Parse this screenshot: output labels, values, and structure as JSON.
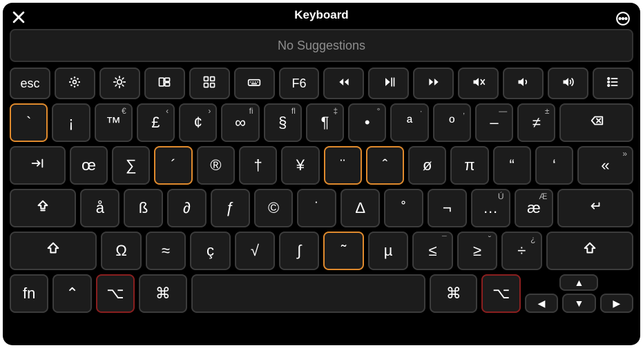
{
  "title": "Keyboard",
  "suggestions": "No Suggestions",
  "function_row": [
    {
      "name": "esc-key",
      "label": "esc",
      "glyph": "text"
    },
    {
      "name": "brightness-down-key",
      "glyph": "bright-low"
    },
    {
      "name": "brightness-up-key",
      "glyph": "bright-high"
    },
    {
      "name": "mission-control-key",
      "glyph": "mission"
    },
    {
      "name": "launchpad-key",
      "glyph": "grid"
    },
    {
      "name": "keyboard-light-key",
      "glyph": "kbd"
    },
    {
      "name": "f6-key",
      "label": "F6",
      "glyph": "text"
    },
    {
      "name": "rewind-key",
      "glyph": "rw"
    },
    {
      "name": "play-pause-key",
      "glyph": "play"
    },
    {
      "name": "forward-key",
      "glyph": "ff"
    },
    {
      "name": "mute-key",
      "glyph": "mute"
    },
    {
      "name": "volume-down-key",
      "glyph": "vol-low"
    },
    {
      "name": "volume-up-key",
      "glyph": "vol-high"
    },
    {
      "name": "list-key",
      "glyph": "list"
    }
  ],
  "row1": [
    {
      "name": "grave-key",
      "label": "`",
      "hl": "orange"
    },
    {
      "name": "inverted-exclamation-key",
      "label": "¡"
    },
    {
      "name": "trademark-key",
      "label": "™",
      "hint": "€"
    },
    {
      "name": "pound-key",
      "label": "£",
      "hint": "‹"
    },
    {
      "name": "cent-key",
      "label": "¢",
      "hint": "›"
    },
    {
      "name": "infinity-key",
      "label": "∞",
      "hint": "ﬁ"
    },
    {
      "name": "section-key",
      "label": "§",
      "hint": "ﬂ"
    },
    {
      "name": "paragraph-key",
      "label": "¶",
      "hint": "‡"
    },
    {
      "name": "bullet-key",
      "label": "•",
      "hint": "°"
    },
    {
      "name": "ordfem-key",
      "label": "ª",
      "hint": "·"
    },
    {
      "name": "ordmasc-key",
      "label": "º",
      "hint": "‚"
    },
    {
      "name": "endash-key",
      "label": "–",
      "hint": "—"
    },
    {
      "name": "notequal-key",
      "label": "≠",
      "hint": "±"
    },
    {
      "name": "delete-key",
      "glyph": "delete",
      "w": "w200"
    }
  ],
  "row2": [
    {
      "name": "tab-key",
      "glyph": "tab",
      "w": "w150"
    },
    {
      "name": "oe-key",
      "label": "œ"
    },
    {
      "name": "sigma-key",
      "label": "∑"
    },
    {
      "name": "acute-key",
      "label": "´",
      "hl": "orange"
    },
    {
      "name": "registered-key",
      "label": "®"
    },
    {
      "name": "dagger-key",
      "label": "†"
    },
    {
      "name": "yen-key",
      "label": "¥"
    },
    {
      "name": "diaeresis-key",
      "label": "¨",
      "hl": "orange"
    },
    {
      "name": "caret-key",
      "label": "ˆ",
      "hl": "orange"
    },
    {
      "name": "oslash-key",
      "label": "ø"
    },
    {
      "name": "pi-key",
      "label": "π"
    },
    {
      "name": "open-quote-key",
      "label": "“"
    },
    {
      "name": "close-quote-key",
      "label": "‘"
    },
    {
      "name": "guillemet-key",
      "label": "«",
      "hint": "»",
      "w": "w150"
    }
  ],
  "row3": [
    {
      "name": "capslock-key",
      "glyph": "caps",
      "w": "w175"
    },
    {
      "name": "aring-key",
      "label": "å"
    },
    {
      "name": "eszett-key",
      "label": "ß"
    },
    {
      "name": "partial-key",
      "label": "∂"
    },
    {
      "name": "florin-key",
      "label": "ƒ"
    },
    {
      "name": "copyright-key",
      "label": "©"
    },
    {
      "name": "overdot-key",
      "label": "˙"
    },
    {
      "name": "delta-key",
      "label": "∆"
    },
    {
      "name": "ring-key",
      "label": "˚"
    },
    {
      "name": "not-key",
      "label": "¬"
    },
    {
      "name": "ellipsis-key",
      "label": "…",
      "hint": "Ú"
    },
    {
      "name": "ae-key",
      "label": "æ",
      "hint": "Æ"
    },
    {
      "name": "return-key",
      "glyph": "return",
      "w": "w200"
    }
  ],
  "row4": [
    {
      "name": "left-shift-key",
      "glyph": "shift",
      "w": "w225"
    },
    {
      "name": "omega-key",
      "label": "Ω"
    },
    {
      "name": "approx-key",
      "label": "≈"
    },
    {
      "name": "ccedil-key",
      "label": "ç"
    },
    {
      "name": "radical-key",
      "label": "√"
    },
    {
      "name": "integral-key",
      "label": "∫"
    },
    {
      "name": "tilde-key",
      "label": "˜",
      "hl": "orange"
    },
    {
      "name": "mu-key",
      "label": "µ"
    },
    {
      "name": "lessequal-key",
      "label": "≤",
      "hint": "¯"
    },
    {
      "name": "greaterequal-key",
      "label": "≥",
      "hint": "˘"
    },
    {
      "name": "divide-key",
      "label": "÷",
      "hint": "¿"
    },
    {
      "name": "right-shift-key",
      "glyph": "shift",
      "w": "w225"
    }
  ],
  "row5": [
    {
      "name": "fn-key",
      "label": "fn",
      "w": "w100"
    },
    {
      "name": "control-key",
      "label": "⌃",
      "w": "w100"
    },
    {
      "name": "left-option-key",
      "label": "⌥",
      "hl": "red",
      "w": "w100"
    },
    {
      "name": "left-command-key",
      "label": "⌘",
      "w": "w125"
    },
    {
      "name": "spacebar-key",
      "label": "",
      "w": "w600"
    },
    {
      "name": "right-command-key",
      "label": "⌘",
      "w": "w125"
    },
    {
      "name": "right-option-key",
      "label": "⌥",
      "hl": "red",
      "w": "w100"
    }
  ],
  "arrows": {
    "up": "▲",
    "left": "◀",
    "down": "▼",
    "right": "▶"
  }
}
